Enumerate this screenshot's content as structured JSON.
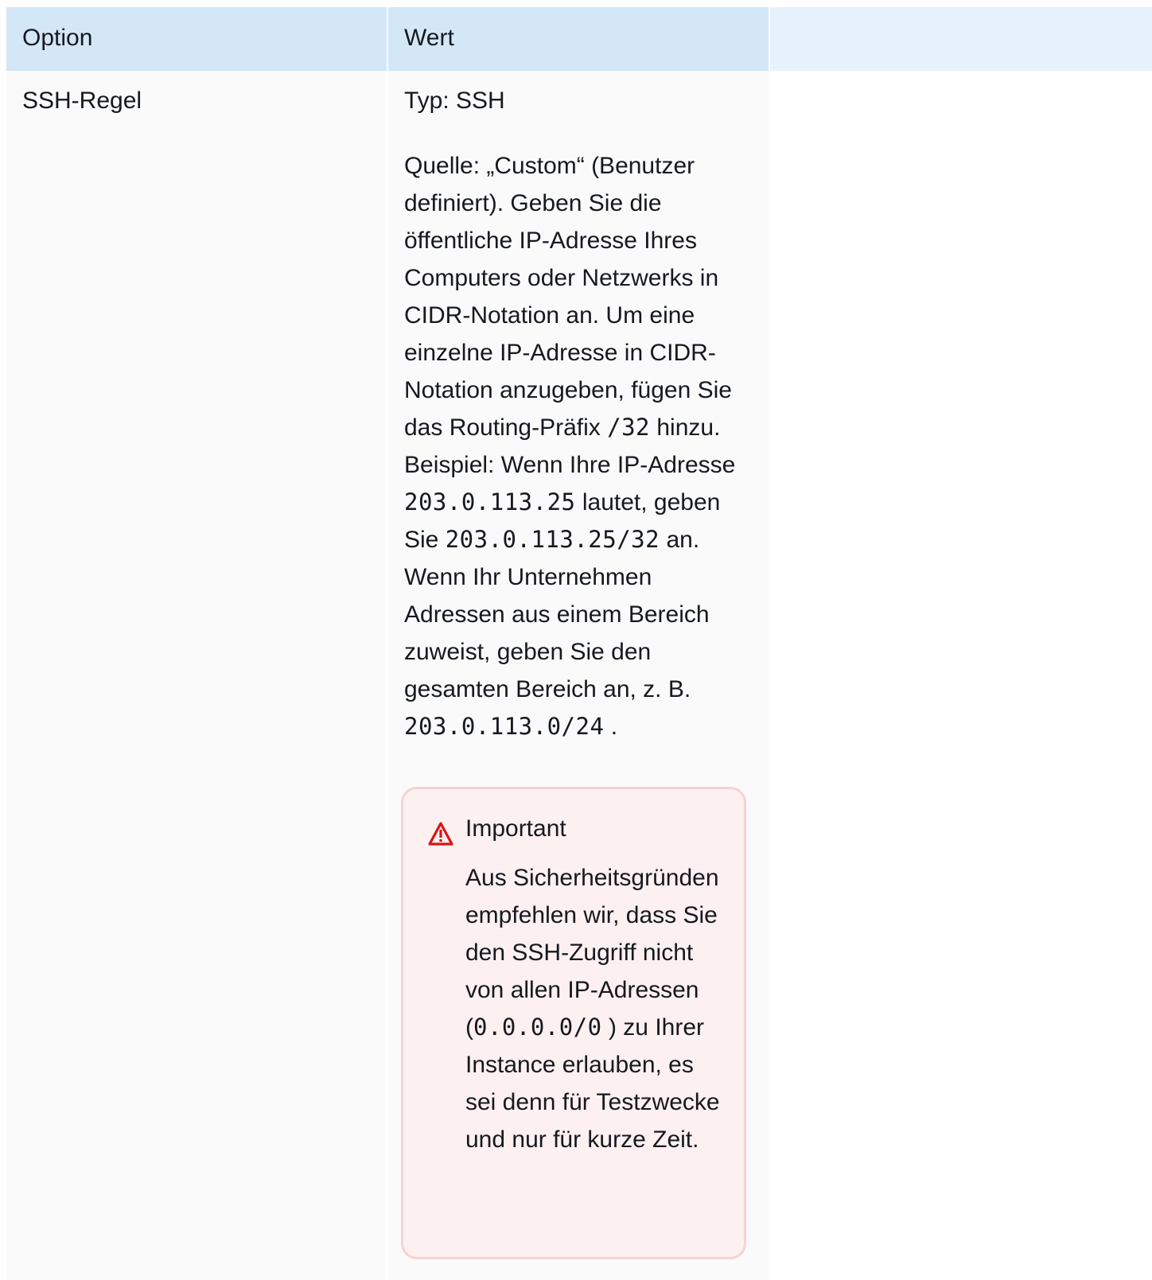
{
  "table": {
    "headers": {
      "option": "Option",
      "value": "Wert"
    },
    "row": {
      "option": "SSH-Regel",
      "type_line": "Typ: SSH",
      "description": {
        "part1": "Quelle: „Custom“ (Benutzer definiert). Geben Sie die öffentliche IP-Adresse Ihres Computers oder Netzwerks in CIDR-Notation an. Um eine einzelne IP-Adresse in CIDR-Notation anzugeben, fügen Sie das Routing-Präfix ",
        "code1": "/32",
        "part2": " hinzu. Beispiel: Wenn Ihre IP-Adresse ",
        "code2": "203.0.113.25",
        "part3": " lautet, geben Sie ",
        "code3": "203.0.113.25/32",
        "part4": " an. Wenn Ihr Unternehmen Adressen aus einem Bereich zuweist, geben Sie den gesamten Bereich an, z. B. ",
        "code4": "203.0.113.0/24",
        "part5": " ."
      },
      "important": {
        "title": "Important",
        "part1": "Aus Sicherheitsgründen empfehlen wir, dass Sie den SSH-Zugriff nicht von allen IP-Adressen (",
        "code": "0.0.0.0/0",
        "part2": " ) zu Ihrer Instance erlauben, es sei denn für Testzwecke und nur für kurze Zeit."
      }
    }
  },
  "colors": {
    "header_bg": "#d4e7f7",
    "header_extra_bg": "#e8f2fd",
    "cell_bg": "#fafafa",
    "important_bg": "#fcf0f0",
    "important_border": "#f7d2d3",
    "warning_icon": "#d91515"
  },
  "icons": {
    "important": "warning-triangle-icon"
  }
}
